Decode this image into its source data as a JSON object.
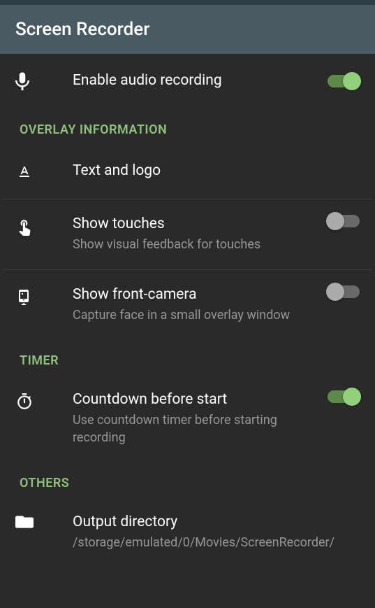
{
  "header": {
    "title": "Screen Recorder"
  },
  "sections": {
    "audio": {
      "enable_audio_label": "Enable audio recording"
    },
    "overlay": {
      "header": "OVERLAY INFORMATION",
      "text_logo_label": "Text and logo",
      "show_touches_label": "Show touches",
      "show_touches_desc": "Show visual feedback for touches",
      "front_camera_label": "Show front-camera",
      "front_camera_desc": "Capture face in a small overlay window"
    },
    "timer": {
      "header": "TIMER",
      "countdown_label": "Countdown before start",
      "countdown_desc": "Use countdown timer before starting recording"
    },
    "others": {
      "header": "OTHERS",
      "output_dir_label": "Output directory",
      "output_dir_desc": "/storage/emulated/0/Movies/ScreenRecorder/"
    }
  },
  "toggles": {
    "audio": true,
    "touches": false,
    "front_camera": false,
    "countdown": true
  }
}
